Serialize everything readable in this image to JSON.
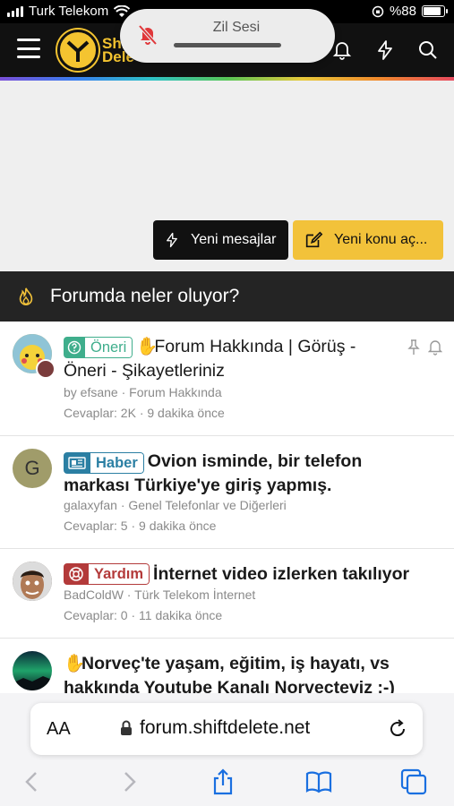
{
  "status_bar": {
    "carrier": "Turk Telekom",
    "battery": "%88",
    "battery_level": 0.88
  },
  "notification": {
    "title": "Zil Sesi",
    "icon": "bell-slash-icon"
  },
  "header": {
    "logo_text_1": "Shi",
    "logo_text_2": "Dele",
    "icons": [
      "menu-icon",
      "bell-icon",
      "bolt-icon",
      "search-icon"
    ]
  },
  "actions": {
    "new_messages": "Yeni mesajlar",
    "new_thread": "Yeni konu aç..."
  },
  "section": {
    "title": "Forumda neler oluyor?"
  },
  "threads": [
    {
      "prefix": "Öneri",
      "prefix_color": "#3fae8c",
      "emoji": "clap",
      "title": "Forum Hakkında | Görüş - Öneri - Şikayetleriniz",
      "title_line1": "Forum Hakkında | Görüş -",
      "title_line2": "Öneri - Şikayetleriniz",
      "author_forum": "by efsane · Forum Hakkında",
      "stats": "Cevaplar: 2K · 9 dakika önce",
      "bold": false
    },
    {
      "prefix": "Haber",
      "prefix_color": "#2b7fa3",
      "title_line1": "Ovion isminde, bir telefon",
      "title_line2": "markası Türkiye'ye giriş yapmış.",
      "avatar_letter": "G",
      "author_forum": "galaxyfan · Genel Telefonlar ve Diğerleri",
      "stats": "Cevaplar: 5 · 9 dakika önce",
      "bold": true
    },
    {
      "prefix": "Yardım",
      "prefix_color": "#b33a3a",
      "title_line1": "İnternet video izlerken takılıyor",
      "author_forum": "BadColdW · Türk Telekom İnternet",
      "stats": "Cevaplar: 0 · 11 dakika önce",
      "bold": true
    },
    {
      "emoji": "clap",
      "title_line1": "Norveç'te yaşam, eğitim, iş hayatı, vs",
      "title_line2": "hakkında Youtube Kanalı Norvecteviz :-)",
      "bold": true
    }
  ],
  "browser": {
    "aa_label": "AA",
    "url": "forum.shiftdelete.net",
    "toolbar": [
      "back-icon",
      "forward-icon",
      "share-icon",
      "bookmarks-icon",
      "tabs-icon"
    ]
  }
}
